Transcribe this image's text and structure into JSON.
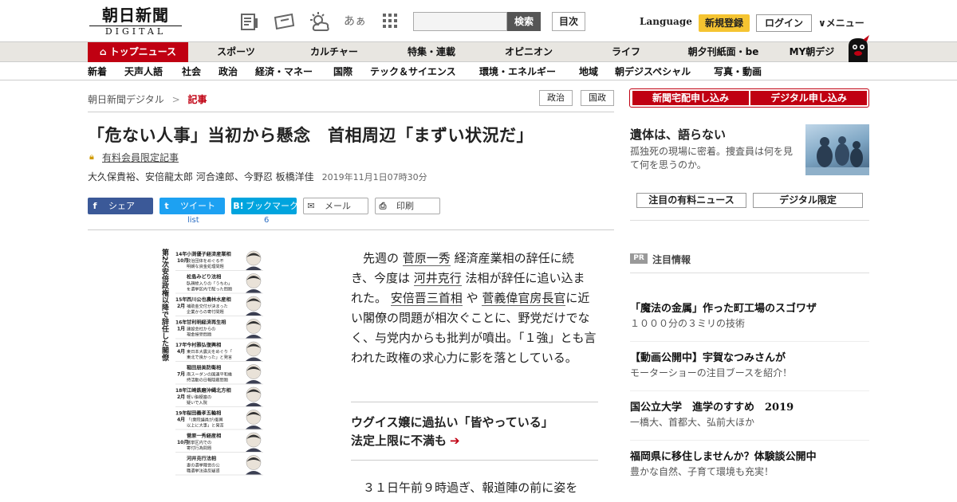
{
  "header": {
    "logo_main": "朝日新聞",
    "logo_sub": "DIGITAL",
    "search_button": "検索",
    "toc_button": "目次",
    "language": "Language",
    "register": "新規登録",
    "login": "ログイン",
    "menu": "メニュー",
    "text_size_glyph": "あぁ"
  },
  "nav_primary": [
    "トップニュース",
    "スポーツ",
    "カルチャー",
    "特集・連載",
    "オピニオン",
    "ライフ",
    "朝夕刊紙面・be",
    "MY朝デジ"
  ],
  "nav_secondary": [
    "新着",
    "天声人語",
    "社会",
    "政治",
    "経済・マネー",
    "国際",
    "テック＆サイエンス",
    "環境・エネルギー",
    "地域",
    "朝デジスペシャル",
    "写真・動画"
  ],
  "breadcrumb": {
    "home": "朝日新聞デジタル",
    "sep": ">",
    "current": "記事"
  },
  "tags": [
    "政治",
    "国政"
  ],
  "article": {
    "headline": "「危ない人事」当初から懸念　首相周辺「まずい状況だ」",
    "members_only": "有料会員限定記事",
    "authors": "大久保貴裕、安倍龍太郎 河合達郎、今野忍 板橋洋佳",
    "date": "2019年11月1日07時30分",
    "share": [
      {
        "icon": "f",
        "label": "シェア"
      },
      {
        "icon": "t",
        "label": "ツイート"
      },
      {
        "icon": "B!",
        "label": "ブックマーク"
      },
      {
        "icon": "✉",
        "label": "メール"
      },
      {
        "icon": "⎙",
        "label": "印刷"
      }
    ],
    "tweet_count": "list",
    "bookmark_count": "6",
    "body_p1_parts": [
      "先週の",
      "菅原一秀",
      "経済産業相の辞任に続き、今度は",
      "河井克行",
      "法相が辞任に追い込まれた。",
      "安倍晋三首相",
      "や",
      "菅義偉官房長官",
      "に近い閣僚の問題が相次ぐことに、野党だけでなく、与党内からも批判が噴出。「１強」とも言われた政権の求心力に影を落としている。"
    ],
    "sub_link_line1": "ウグイス嬢に過払い「皆やっている」",
    "sub_link_line2": "法定上限に不満も",
    "body_p2": "３１日午前９時過ぎ、報道陣の前に姿を"
  },
  "figure": {
    "title": "第2次安倍政権以降で辞任した閣僚",
    "entries": [
      {
        "year": "14年",
        "month": "10月",
        "name": "小渕優子経済産業相",
        "desc": "政治団体をめぐる不明朗な資金処理問題"
      },
      {
        "year": "",
        "month": "",
        "name": "松島みどり法相",
        "desc": "臥顔絵入りの「うちわ」を選挙区内で配った問題"
      },
      {
        "year": "15年",
        "month": "2月",
        "name": "西川公也農林水産相",
        "desc": "補助金交付が決まった企業からの寄付問題"
      },
      {
        "year": "16年",
        "month": "1月",
        "name": "甘利明経済再生相",
        "desc": "建設会社からの現金授受問題"
      },
      {
        "year": "17年",
        "month": "4月",
        "name": "今村雅弘復興相",
        "desc": "東日本大震災をめぐり「東北で良かった」と発言"
      },
      {
        "year": "",
        "month": "7月",
        "name": "稲田朋美防衛相",
        "desc": "南スーダンの国連平和維持活動の日報隠蔽問題"
      },
      {
        "year": "18年",
        "month": "2月",
        "name": "江崎鉄磨沖縄北方相",
        "desc": "軽い脳梗塞の疑いで入院"
      },
      {
        "year": "19年",
        "month": "4月",
        "name": "桜田義孝五輪相",
        "desc": "「(衆院議員が)復興以上に大事」と発言"
      },
      {
        "year": "",
        "month": "10月",
        "name": "菅原一秀経産相",
        "desc": "選挙区内での寄付行為問題"
      },
      {
        "year": "",
        "month": "",
        "name": "河井克行法相",
        "desc": "妻の選挙陣営の公職選挙法違反疑惑"
      }
    ]
  },
  "sidebar": {
    "apply_home": "新聞宅配申し込み",
    "apply_digital": "デジタル申し込み",
    "feature_title": "遺体は、語らない",
    "feature_desc": "孤独死の現場に密着。捜査員は何を見て何を思うのか。",
    "btn_paid_news": "注目の有料ニュース",
    "btn_digital_only": "デジタル限定",
    "pr_badge": "PR",
    "pr_label": "注目情報",
    "pr_items": [
      {
        "title": "「魔法の金属」作った町工場のスゴワザ",
        "desc": "１０００分の３ミリの技術"
      },
      {
        "title": "【動画公開中】宇賀なつみさんが",
        "desc": "モーターショーの注目ブースを紹介！"
      },
      {
        "title": "国公立大学　進学のすすめ　2019",
        "desc": "一橋大、首都大、弘前大ほか"
      },
      {
        "title": "福岡県に移住しませんか？体験談公開中",
        "desc": "豊かな自然、子育て環境も充実！"
      }
    ]
  },
  "colors": {
    "brand_red": "#c00012",
    "register_yellow": "#f5c431",
    "facebook": "#3b5998",
    "twitter": "#1da1f2",
    "hatena": "#00a4de"
  }
}
